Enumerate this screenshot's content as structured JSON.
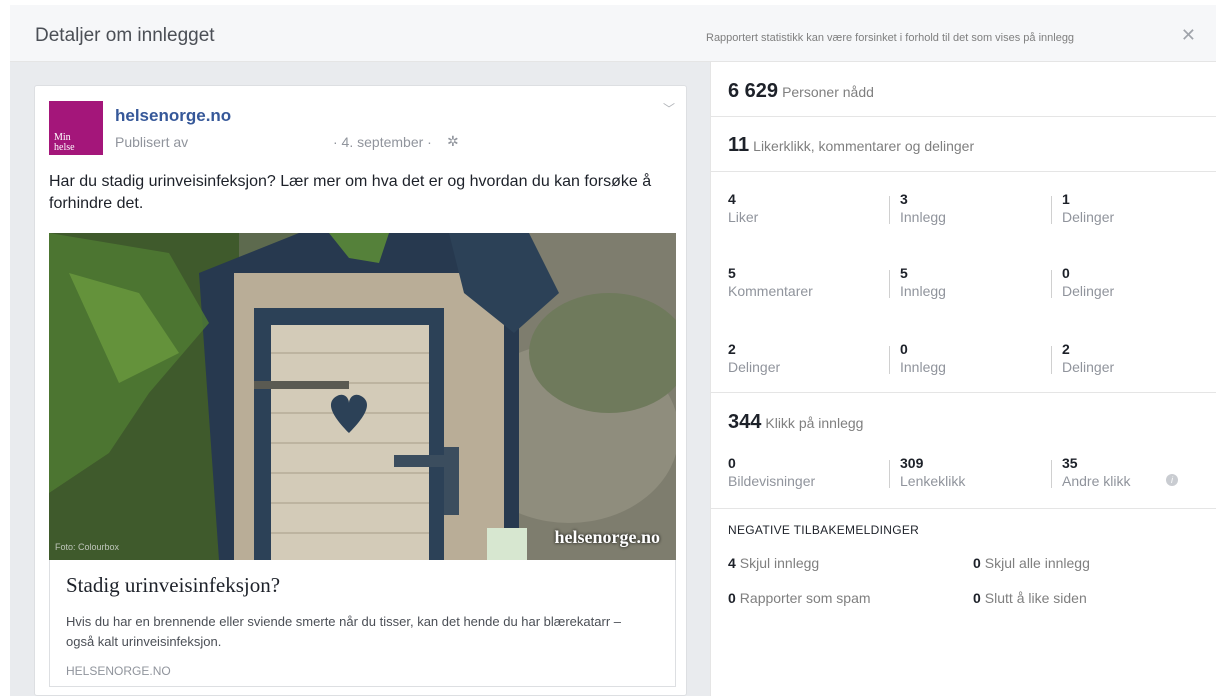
{
  "header": {
    "title": "Detaljer om innlegget",
    "note": "Rapportert statistikk kan være forsinket i forhold til det som vises på innlegg",
    "close_icon": "close-icon"
  },
  "post": {
    "page_name": "helsenorge.no",
    "avatar_text_line1": "Min",
    "avatar_text_line2": "helse",
    "published_by": "Publisert av",
    "date": "· 4. september ·",
    "text": "Har du stadig urinveisinfeksjon? Lær mer om hva det er og hvordan du kan forsøke å forhindre det.",
    "image_watermark": "helsenorge.no",
    "image_credit": "Foto: Colourbox",
    "link_title": "Stadig urinveisinfeksjon?",
    "link_desc": "Hvis du har en brennende eller sviende smerte når du tisser, kan det hende du har blærekatarr – også kalt urinveisinfeksjon.",
    "link_domain": "HELSENORGE.NO",
    "colors": {
      "brand": "#a4167a",
      "link": "#365899"
    }
  },
  "stats": {
    "reach": {
      "value": "6 629",
      "label": "Personer nådd"
    },
    "engagement": {
      "value": "11",
      "label": "Likerklikk, kommentarer og delinger"
    },
    "grid": [
      [
        {
          "num": "4",
          "label": "Liker"
        },
        {
          "num": "3",
          "label": "Innlegg"
        },
        {
          "num": "1",
          "label": "Delinger"
        }
      ],
      [
        {
          "num": "5",
          "label": "Kommentarer"
        },
        {
          "num": "5",
          "label": "Innlegg"
        },
        {
          "num": "0",
          "label": "Delinger"
        }
      ],
      [
        {
          "num": "2",
          "label": "Delinger"
        },
        {
          "num": "0",
          "label": "Innlegg"
        },
        {
          "num": "2",
          "label": "Delinger"
        }
      ]
    ],
    "clicks": {
      "value": "344",
      "label": "Klikk på innlegg"
    },
    "click_breakdown": [
      {
        "num": "0",
        "label": "Bildevisninger"
      },
      {
        "num": "309",
        "label": "Lenkeklikk"
      },
      {
        "num": "35",
        "label": "Andre klikk"
      }
    ],
    "negative": {
      "heading": "NEGATIVE TILBAKEMELDINGER",
      "items": [
        {
          "num": "4",
          "label": "Skjul innlegg"
        },
        {
          "num": "0",
          "label": "Skjul alle innlegg"
        },
        {
          "num": "0",
          "label": "Rapporter som spam"
        },
        {
          "num": "0",
          "label": "Slutt å like siden"
        }
      ]
    }
  }
}
